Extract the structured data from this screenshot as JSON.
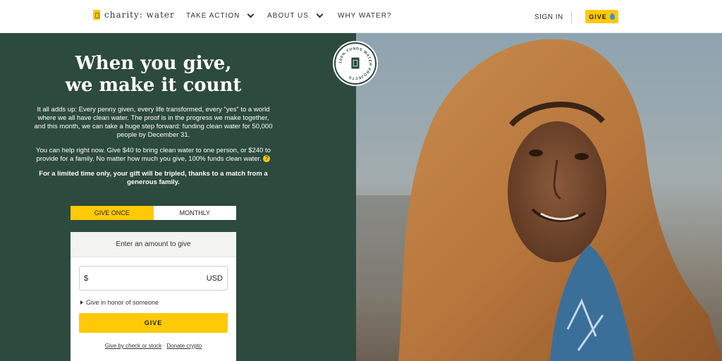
{
  "header": {
    "logo_text": "charity: water",
    "nav": [
      {
        "label": "TAKE ACTION",
        "dropdown": true
      },
      {
        "label": "ABOUT US",
        "dropdown": true
      },
      {
        "label": "WHY WATER?",
        "dropdown": false
      }
    ],
    "sign_in": "SIGN IN",
    "give": "GIVE"
  },
  "hero": {
    "headline_line1": "When you give,",
    "headline_line2": "we make it count",
    "para1": "It all adds up: Every penny given, every life transformed, every “yes” to a world where we all have clean water. The proof is in the progress we make together, and this month, we can take a huge step forward: funding clean water for 50,000 people by December 31.",
    "para2": "You can help right now. Give $40 to bring clean water to one person, or $240 to provide for a family. No matter how much you give, 100% funds clean water.",
    "para2_help": "?",
    "para3": "For a limited time only, your gift will be tripled, thanks to a match from a generous family."
  },
  "donation": {
    "tab_once": "GIVE ONCE",
    "tab_monthly": "MONTHLY",
    "selected_tab": "GIVE ONCE",
    "form_title": "Enter an amount to give",
    "currency_symbol": "$",
    "amount_value": "",
    "currency": "USD",
    "honor": "Give in honor of someone",
    "give_button": "GIVE",
    "link_check": "Give by check or stock",
    "link_sep": " · ",
    "link_crypto": "Donate crypto"
  },
  "badge": {
    "text": "100% FUNDS WATER PROJECTS"
  },
  "colors": {
    "accent": "#ffc907",
    "panel": "#2d4a3e"
  }
}
